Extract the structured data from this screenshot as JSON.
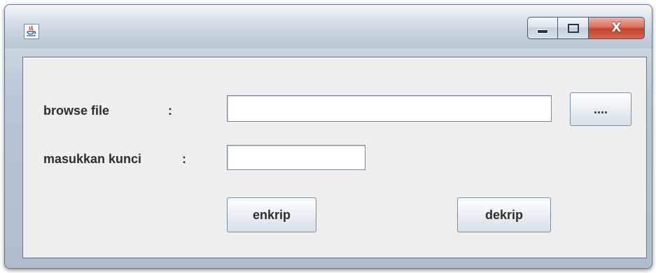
{
  "window": {
    "title": "",
    "controls": {
      "minimize_icon": "minimize-icon",
      "maximize_icon": "maximize-icon",
      "close_label": "X"
    }
  },
  "form": {
    "browse_label": "browse file",
    "browse_colon": ":",
    "browse_value": "",
    "browse_button": "....",
    "key_label": "masukkan kunci",
    "key_colon": ":",
    "key_value": "",
    "encrypt_button": "enkrip",
    "decrypt_button": "dekrip"
  }
}
